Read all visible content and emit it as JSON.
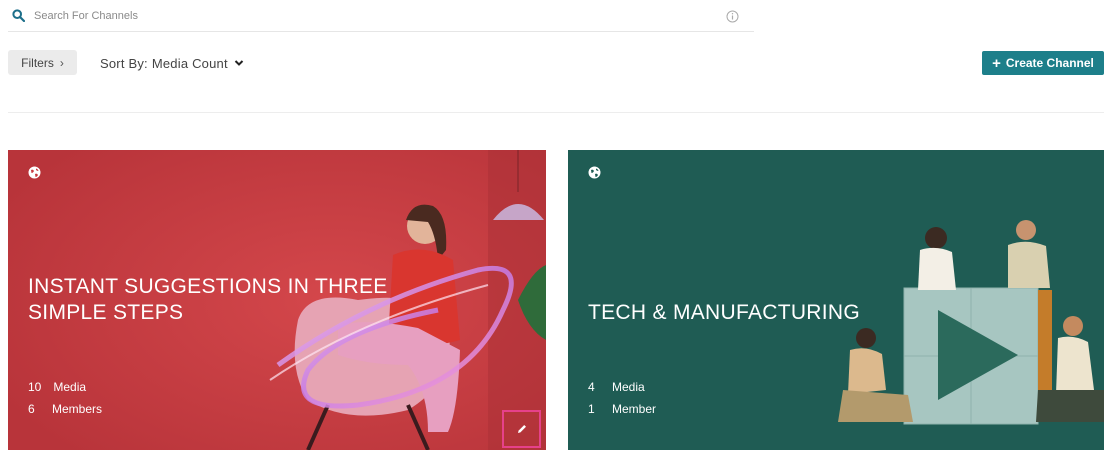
{
  "search": {
    "placeholder": "Search For Channels",
    "value": ""
  },
  "toolbar": {
    "filters_label": "Filters",
    "sort_prefix": "Sort By:",
    "sort_value": "Media Count",
    "create_label": "Create Channel"
  },
  "colors": {
    "accent": "#1d7f8a",
    "card_red": "#c73a3f",
    "card_green": "#1f5c54",
    "highlight": "#e6418a"
  },
  "channels": [
    {
      "title": "INSTANT SUGGESTIONS IN THREE SIMPLE STEPS",
      "visibility_icon": "globe-icon",
      "media_count": "10",
      "media_label": "Media",
      "members_count": "6",
      "members_label": "Members"
    },
    {
      "title": "TECH & MANUFACTURING",
      "visibility_icon": "globe-icon",
      "media_count": "4",
      "media_label": "Media",
      "members_count": "1",
      "members_label": "Member"
    }
  ]
}
